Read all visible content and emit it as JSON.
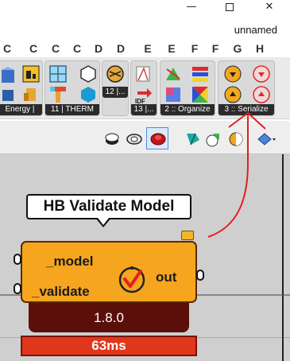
{
  "window": {
    "minimize_glyph": "—",
    "close_glyph": "✕",
    "document_name": "unnamed"
  },
  "tabs": [
    "C",
    "C",
    "C",
    "C",
    "D",
    "D",
    "E",
    "E",
    "F",
    "F",
    "G",
    "H"
  ],
  "ribbon": {
    "panels": [
      {
        "label": "Energy |"
      },
      {
        "label": "11 | THERM"
      },
      {
        "label": "12 |..."
      },
      {
        "label": "13 |..."
      },
      {
        "label": "2 :: Organize"
      },
      {
        "label": "3 :: Serialize"
      }
    ],
    "idf_text": "IDF"
  },
  "toolbar_icons": [
    "preview-off-icon",
    "preview-wire-icon",
    "preview-shaded-icon",
    "display-icon-1",
    "display-icon-2",
    "display-icon-3",
    "sphere-icon"
  ],
  "canvas": {
    "callout_text": "HB Validate Model",
    "component": {
      "inputs": [
        "_model",
        "_validate"
      ],
      "output": "out",
      "version": "1.8.0",
      "timing": "63ms"
    }
  },
  "colors": {
    "component_fill": "#f6a51f",
    "timing_fill": "#e0361b",
    "annotation_arrow": "#e02020"
  }
}
